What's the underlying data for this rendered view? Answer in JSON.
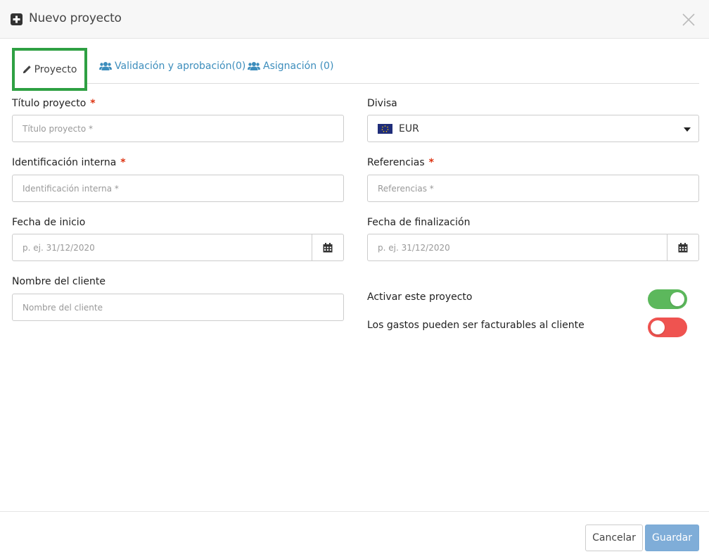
{
  "header": {
    "title": "Nuevo proyecto",
    "icon": "plus-square-icon",
    "close_icon": "close-icon"
  },
  "tabs": [
    {
      "label": "Proyecto",
      "icon": "pencil-icon",
      "active": true
    },
    {
      "label": "Validación y aprobación(0)",
      "icon": "users-icon",
      "active": false
    },
    {
      "label": "Asignación (0)",
      "icon": "users-icon",
      "active": false
    }
  ],
  "form": {
    "titulo": {
      "label": "Título proyecto",
      "required_mark": "*",
      "value": "",
      "placeholder": "Título proyecto *"
    },
    "divisa": {
      "label": "Divisa",
      "value": "EUR",
      "flag_icon": "eu-flag-icon"
    },
    "identificacion": {
      "label": "Identificación interna",
      "required_mark": "*",
      "value": "",
      "placeholder": "Identificación interna *"
    },
    "referencias": {
      "label": "Referencias",
      "required_mark": "*",
      "value": "",
      "placeholder": "Referencias *"
    },
    "fecha_inicio": {
      "label": "Fecha de inicio",
      "value": "",
      "placeholder": "p. ej. 31/12/2020",
      "icon": "calendar-icon"
    },
    "fecha_fin": {
      "label": "Fecha de finalización",
      "value": "",
      "placeholder": "p. ej. 31/12/2020",
      "icon": "calendar-icon"
    },
    "cliente": {
      "label": "Nombre del cliente",
      "value": "",
      "placeholder": "Nombre del cliente"
    },
    "activar": {
      "label": "Activar este proyecto",
      "on": true
    },
    "facturables": {
      "label": "Los gastos pueden ser facturables al cliente",
      "on": false
    }
  },
  "footer": {
    "cancel_label": "Cancelar",
    "save_label": "Guardar"
  },
  "colors": {
    "active_tab_border": "#2ea043",
    "link": "#3c8dbc",
    "required": "#dd3311",
    "toggle_on": "#5cb85c",
    "toggle_off": "#ef5350",
    "save_button": "#7fadd8"
  }
}
